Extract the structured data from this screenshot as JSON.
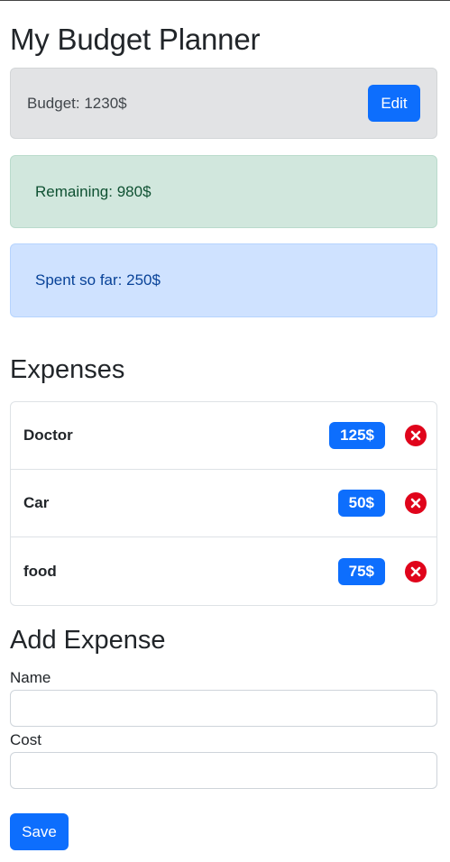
{
  "app": {
    "title": "My Budget Planner"
  },
  "budget": {
    "text": "Budget: 1230$",
    "edit_label": "Edit"
  },
  "remaining": {
    "text": "Remaining: 980$"
  },
  "spent": {
    "text": "Spent so far: 250$"
  },
  "expenses": {
    "title": "Expenses",
    "items": [
      {
        "name": "Doctor",
        "cost": "125$"
      },
      {
        "name": "Car",
        "cost": "50$"
      },
      {
        "name": "food",
        "cost": "75$"
      }
    ]
  },
  "add_expense": {
    "title": "Add Expense",
    "name_label": "Name",
    "name_value": "",
    "cost_label": "Cost",
    "cost_value": "",
    "save_label": "Save"
  },
  "icons": {
    "delete": "close-circle-icon"
  },
  "colors": {
    "primary": "#0d6efd",
    "danger": "#e0041b"
  }
}
